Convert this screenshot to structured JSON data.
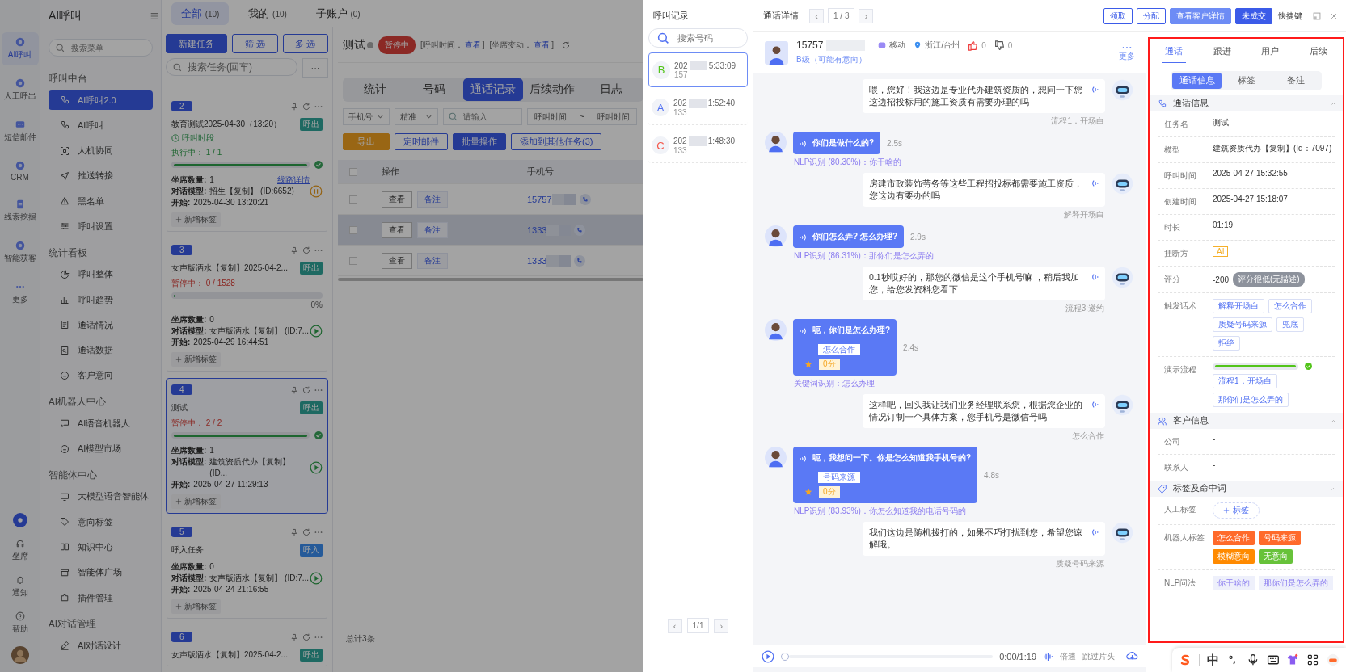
{
  "rail": {
    "items": [
      {
        "label": "AI呼叫",
        "selected": true
      },
      {
        "label": "人工呼出",
        "selected": false
      },
      {
        "label": "短信邮件",
        "selected": false
      },
      {
        "label": "CRM",
        "selected": false
      },
      {
        "label": "线索挖掘",
        "selected": false
      },
      {
        "label": "智能获客",
        "selected": false
      },
      {
        "label": "更多",
        "selected": false
      }
    ],
    "bottom": [
      {
        "label": "坐席"
      },
      {
        "label": "通知"
      },
      {
        "label": "帮助"
      }
    ]
  },
  "menu": {
    "title": "AI呼叫",
    "search_placeholder": "搜索菜单",
    "sections": [
      {
        "title": "呼叫中台",
        "items": [
          {
            "label": "AI呼叫2.0",
            "selected": true
          },
          {
            "label": "AI呼叫",
            "selected": false
          },
          {
            "label": "人机协同",
            "selected": false
          },
          {
            "label": "推送转接",
            "selected": false
          },
          {
            "label": "黑名单",
            "selected": false
          },
          {
            "label": "呼叫设置",
            "selected": false
          }
        ]
      },
      {
        "title": "统计看板",
        "items": [
          {
            "label": "呼叫整体",
            "selected": false
          },
          {
            "label": "呼叫趋势",
            "selected": false
          },
          {
            "label": "通话情况",
            "selected": false
          },
          {
            "label": "通话数据",
            "selected": false
          },
          {
            "label": "客户意向",
            "selected": false
          }
        ]
      },
      {
        "title": "AI机器人中心",
        "items": [
          {
            "label": "AI语音机器人",
            "selected": false
          },
          {
            "label": "AI模型市场",
            "selected": false
          }
        ]
      },
      {
        "title": "智能体中心",
        "items": [
          {
            "label": "大模型语音智能体",
            "selected": false
          },
          {
            "label": "意向标签",
            "selected": false
          },
          {
            "label": "知识中心",
            "selected": false
          },
          {
            "label": "智能体广场",
            "selected": false
          },
          {
            "label": "插件管理",
            "selected": false
          }
        ]
      },
      {
        "title": "AI对话管理",
        "items": [
          {
            "label": "AI对话设计",
            "selected": false
          }
        ]
      }
    ]
  },
  "task_tabs": [
    {
      "label": "全部",
      "count": "(10)",
      "selected": true
    },
    {
      "label": "我的",
      "count": "(10)",
      "selected": false
    },
    {
      "label": "子账户",
      "count": "(0)",
      "selected": false
    }
  ],
  "task_toolbar": {
    "buttons": [
      "新建任务",
      "筛 选",
      "多 选"
    ],
    "search_placeholder": "搜索任务(回车)",
    "more": "···"
  },
  "tasks": [
    {
      "number": "2",
      "title": "教育测试2025-04-30（13:20）",
      "tag": "呼出",
      "kind": "out",
      "subtitle": "呼叫时段",
      "status": {
        "kind": "running",
        "label": "执行中：",
        "count": "1 / 1"
      },
      "progress": {
        "level": 1,
        "done": true
      },
      "fields": [
        {
          "label": "坐席数量:",
          "value": "1",
          "link": "线路详情"
        },
        {
          "label": "对话模型:",
          "value": "招生【复制】 (ID:6652)"
        },
        {
          "label": "开始:",
          "value": "2025-04-30 13:20:21"
        }
      ],
      "add_tag": "新增标签",
      "selected": false
    },
    {
      "number": "3",
      "title": "女声版洒水【复制】2025-04-2...",
      "tag": "呼出",
      "kind": "out",
      "status": {
        "kind": "paused",
        "label": "暂停中：",
        "count": "0 / 1528"
      },
      "progress": {
        "level": 0,
        "done": false,
        "percent": "0%"
      },
      "fields": [
        {
          "label": "坐席数量:",
          "value": "0"
        },
        {
          "label": "对话模型:",
          "value": "女声版洒水【复制】 (ID:7..."
        },
        {
          "label": "开始:",
          "value": "2025-04-29 16:44:51"
        }
      ],
      "add_tag": "新增标签",
      "selected": false
    },
    {
      "number": "4",
      "title": "测试",
      "tag": "呼出",
      "kind": "out",
      "status": {
        "kind": "paused",
        "label": "暂停中：",
        "count": "2 / 2"
      },
      "progress": {
        "level": 1,
        "done": true
      },
      "fields": [
        {
          "label": "坐席数量:",
          "value": "1"
        },
        {
          "label": "对话模型:",
          "value": "建筑资质代办【复制】 (ID..."
        },
        {
          "label": "开始:",
          "value": "2025-04-27 11:29:13"
        }
      ],
      "add_tag": "新增标签",
      "selected": true
    },
    {
      "number": "5",
      "title": "呼入任务",
      "tag": "呼入",
      "kind": "in",
      "fields": [
        {
          "label": "坐席数量:",
          "value": "0"
        },
        {
          "label": "对话模型:",
          "value": "女声版洒水【复制】 (ID:7..."
        },
        {
          "label": "开始:",
          "value": "2025-04-24 21:16:55"
        }
      ],
      "add_tag": "新增标签",
      "selected": false
    },
    {
      "number": "6",
      "title": "女声版洒水【复制】2025-04-2...",
      "tag": "呼出",
      "kind": "out",
      "selected": false
    }
  ],
  "task_view": {
    "title": "测试",
    "status": "暂停中",
    "meta": [
      {
        "label": "[呼叫时间：",
        "link": "查看",
        "end": "]"
      },
      {
        "label": "[坐席变动：",
        "link": "查看",
        "end": "]"
      }
    ],
    "tabs": [
      {
        "label": "统计",
        "selected": false
      },
      {
        "label": "号码",
        "selected": false
      },
      {
        "label": "通话记录",
        "selected": true
      },
      {
        "label": "后续动作",
        "selected": false
      },
      {
        "label": "日志",
        "selected": false
      }
    ],
    "filters": {
      "field": "手机号",
      "mode": "精准",
      "placeholder": "请输入",
      "date_from": "呼叫时间",
      "date_sep": "~",
      "date_to": "呼叫时间"
    },
    "actions": [
      {
        "label": "导出",
        "kind": "warning"
      },
      {
        "label": "定时邮件",
        "kind": "outline"
      },
      {
        "label": "批量操作",
        "kind": "primary"
      },
      {
        "label": "添加到其他任务(3)",
        "kind": "outline"
      }
    ],
    "columns": [
      "操作",
      "手机号"
    ],
    "header_checked": false,
    "rows": [
      {
        "view": "查看",
        "note": "备注",
        "phone": "15757",
        "checked": false,
        "selected": false
      },
      {
        "view": "查看",
        "note": "备注",
        "phone": "1333",
        "checked": false,
        "selected": true
      },
      {
        "view": "查看",
        "note": "备注",
        "phone": "1333",
        "checked": false,
        "selected": false
      }
    ],
    "total": "总计3条"
  },
  "records": {
    "title": "呼叫记录",
    "search_placeholder": "搜索号码",
    "items": [
      {
        "grade": "B",
        "color": "#52c41a",
        "date": "202",
        "time": "5:33:09",
        "phone": "157",
        "selected": true
      },
      {
        "grade": "A",
        "color": "#4e6ef2",
        "date": "202",
        "time": "1:52:40",
        "phone": "133",
        "selected": false
      },
      {
        "grade": "C",
        "color": "#f5574a",
        "date": "202",
        "time": "1:48:30",
        "phone": "133",
        "selected": false
      }
    ],
    "pager": {
      "prev": "‹",
      "page": "1/1",
      "next": "›"
    }
  },
  "detail": {
    "title": "通话详情",
    "pager": {
      "prev": "‹",
      "page": "1 / 3",
      "next": "›"
    },
    "buttons": [
      {
        "label": "领取",
        "kind": "outline"
      },
      {
        "label": "分配",
        "kind": "outline"
      },
      {
        "label": "查看客户详情",
        "kind": "light"
      },
      {
        "label": "未成交",
        "kind": "primary"
      },
      {
        "label": "快捷键",
        "kind": "text"
      }
    ],
    "customer": {
      "phone": "15757",
      "carrier": "移动",
      "region": "浙江/台州",
      "likes": "0",
      "dislikes": "0",
      "grade": "B级（可能有意向）",
      "more": "更多"
    }
  },
  "messages": [
    {
      "kind": "robot",
      "text": "喂，您好！我这边是专业代办建筑资质的，想问一下您这边招投标用的施工资质有需要办理的吗",
      "note": "流程1：开场白"
    },
    {
      "kind": "user",
      "text": "你们是做什么的?",
      "duration": "2.5s",
      "note": "NLP识别 (80.30%)：你干啥的"
    },
    {
      "kind": "robot",
      "text": "房建市政装饰劳务等这些工程招投标都需要施工资质，您这边有要办的吗",
      "note": "解释开场白"
    },
    {
      "kind": "user",
      "text": "你们怎么弄? 怎么办理?",
      "duration": "2.9s",
      "note": "NLP识别 (86.31%)：那你们是怎么弄的"
    },
    {
      "kind": "robot",
      "text": "0.1秒哎好的，那您的微信是这个手机号嘛 ，稍后我加您，给您发资料您看下",
      "note": "流程3:邀约"
    },
    {
      "kind": "user",
      "text": "呃，你们是怎么办理?",
      "intent": "怎么合作",
      "score": "0分",
      "duration": "2.4s",
      "note": "关键词识别：怎么办理"
    },
    {
      "kind": "robot",
      "text": "这样吧，回头我让我们业务经理联系您，根据您企业的情况订制一个具体方案，您手机号是微信号吗",
      "note": "怎么合作"
    },
    {
      "kind": "user",
      "text": "呃，我想问一下。你是怎么知道我手机号的?",
      "intent": "号码来源",
      "score": "0分",
      "duration": "4.8s",
      "note": "NLP识别 (83.93%)：你怎么知道我的电话号码的"
    },
    {
      "kind": "robot",
      "text": "我们这边是随机拨打的，如果不巧打扰到您，希望您谅解哦。",
      "note": "质疑号码来源"
    }
  ],
  "player": {
    "level": 0,
    "time": "0:00/1:19",
    "speed": "倍速",
    "skip": "跳过片头"
  },
  "panel": {
    "tabs": [
      {
        "label": "通话",
        "selected": true
      },
      {
        "label": "跟进",
        "selected": false
      },
      {
        "label": "用户",
        "selected": false
      },
      {
        "label": "后续",
        "selected": false
      }
    ],
    "segments": [
      {
        "label": "通话信息",
        "selected": true
      },
      {
        "label": "标签",
        "selected": false
      },
      {
        "label": "备注",
        "selected": false
      }
    ],
    "sections": [
      {
        "title": "通话信息",
        "fields": [
          {
            "kind": "text",
            "label": "任务名",
            "value": "测试"
          },
          {
            "kind": "text",
            "label": "模型",
            "value": "建筑资质代办【复制】(Id：7097)"
          },
          {
            "kind": "text",
            "label": "呼叫时间",
            "value": "2025-04-27 15:32:55"
          },
          {
            "kind": "text",
            "label": "创建时间",
            "value": "2025-04-27 15:18:07"
          },
          {
            "kind": "text",
            "label": "时长",
            "value": "01:19"
          },
          {
            "kind": "badge",
            "label": "挂断方",
            "value": "AI"
          },
          {
            "kind": "score",
            "label": "评分",
            "value": "-200",
            "badge": "评分很低(无描述)"
          },
          {
            "kind": "tags",
            "label": "触发话术",
            "tags": [
              {
                "label": "解释开场白"
              },
              {
                "label": "怎么合作"
              },
              {
                "label": "质疑号码来源"
              },
              {
                "label": "兜底"
              },
              {
                "label": "拒绝"
              }
            ]
          },
          {
            "kind": "flow",
            "label": "演示流程",
            "level": 1,
            "tags": [
              {
                "label": "流程1：开场白"
              },
              {
                "label": "那你们是怎么弄的"
              }
            ]
          }
        ]
      },
      {
        "title": "客户信息",
        "fields": [
          {
            "kind": "text",
            "label": "公司",
            "value": "-"
          },
          {
            "kind": "text",
            "label": "联系人",
            "value": "-"
          }
        ]
      },
      {
        "title": "标签及命中词",
        "fields": [
          {
            "kind": "add",
            "label": "人工标签",
            "value": "标签"
          },
          {
            "kind": "colortags",
            "label": "机器人标签",
            "tags": [
              {
                "label": "怎么合作",
                "color": "#ff6a2b"
              },
              {
                "label": "号码来源",
                "color": "#ff6a2b"
              },
              {
                "label": "模糊意向",
                "color": "#ff8a00"
              },
              {
                "label": "无意向",
                "color": "#67c23a"
              }
            ]
          },
          {
            "kind": "softtags",
            "label": "NLP问法",
            "tags": [
              {
                "label": "你干啥的"
              },
              {
                "label": "那你们是怎么弄的"
              }
            ]
          }
        ]
      }
    ]
  },
  "ime": {
    "mode": "中"
  }
}
